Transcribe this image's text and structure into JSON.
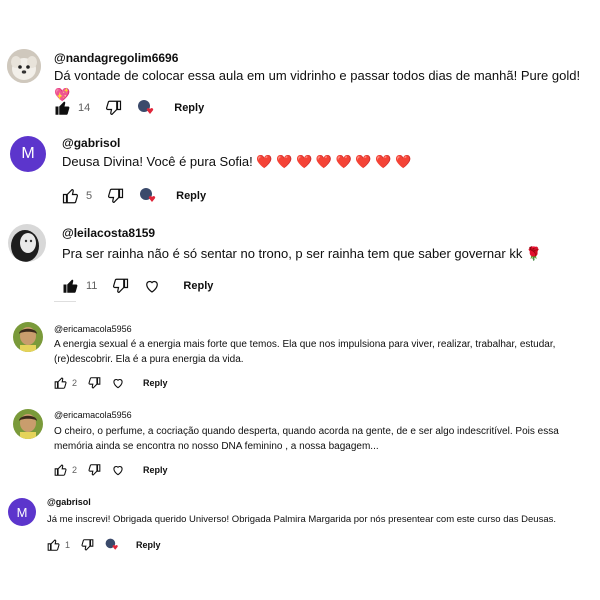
{
  "comments": [
    {
      "handle": "@nandagregolim6696",
      "text": "Dá vontade de colocar essa aula em um vidrinho e passar todos dias de manhã! Pure gold! 💖",
      "likes": "14",
      "liked": true,
      "creator_heart": true,
      "reply_label": "Reply",
      "avatar": {
        "type": "photo",
        "icon": "dog-avatar"
      }
    },
    {
      "handle": "@gabrisol",
      "text": "Deusa Divina! Você é pura Sofia! ❤️ ❤️ ❤️ ❤️ ❤️ ❤️ ❤️ ❤️",
      "likes": "5",
      "liked": false,
      "creator_heart": true,
      "reply_label": "Reply",
      "avatar": {
        "type": "letter",
        "letter": "M",
        "color": "#5c35cc"
      }
    },
    {
      "handle": "@leilacosta8159",
      "text": "Pra ser rainha não é só sentar no trono, p ser rainha tem que saber governar kk 🌹",
      "likes": "11",
      "liked": true,
      "creator_heart": false,
      "reply_label": "Reply",
      "avatar": {
        "type": "photo",
        "icon": "woman-bw-avatar"
      }
    },
    {
      "handle": "@ericamacola5956",
      "text": "A energia sexual é a energia mais forte que temos. Ela que nos impulsiona para viver, realizar, trabalhar, estudar, (re)descobrir. Ela é a pura energia da vida.",
      "likes": "2",
      "liked": false,
      "creator_heart": false,
      "reply_label": "Reply",
      "avatar": {
        "type": "photo",
        "icon": "woman-green-avatar"
      }
    },
    {
      "handle": "@ericamacola5956",
      "text": "O cheiro,  o perfume, a cocriação quando desperta, quando acorda na gente, de e ser algo indescritível. Pois essa memória ainda se encontra no nosso DNA feminino ,  a nossa bagagem...",
      "likes": "2",
      "liked": false,
      "creator_heart": false,
      "reply_label": "Reply",
      "avatar": {
        "type": "photo",
        "icon": "woman-green-avatar"
      }
    },
    {
      "handle": "@gabrisol",
      "text": "Já me inscrevi! Obrigada querido Universo! Obrigada Palmira Margarida por nós presentear com este curso das Deusas.",
      "likes": "1",
      "liked": false,
      "creator_heart": true,
      "reply_label": "Reply",
      "avatar": {
        "type": "letter",
        "letter": "M",
        "color": "#5c35cc"
      }
    }
  ],
  "colors": {
    "avatar_purple": "#5c35cc",
    "heart_red": "#e0263a",
    "secondary_text": "#606060"
  }
}
